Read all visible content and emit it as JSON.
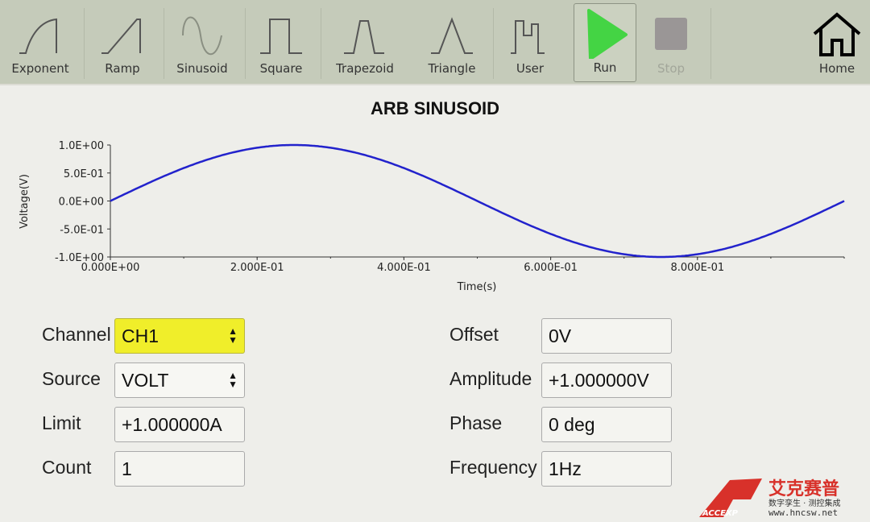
{
  "toolbar": {
    "items": [
      {
        "label": "Exponent",
        "icon": "exponent-wave-icon"
      },
      {
        "label": "Ramp",
        "icon": "ramp-wave-icon"
      },
      {
        "label": "Sinusoid",
        "icon": "sine-wave-icon"
      },
      {
        "label": "Square",
        "icon": "square-wave-icon"
      },
      {
        "label": "Trapezoid",
        "icon": "trapezoid-wave-icon"
      },
      {
        "label": "Triangle",
        "icon": "triangle-wave-icon"
      },
      {
        "label": "User",
        "icon": "user-wave-icon"
      },
      {
        "label": "Run",
        "icon": "play-icon"
      },
      {
        "label": "Stop",
        "icon": "stop-icon"
      },
      {
        "label": "Home",
        "icon": "home-icon"
      }
    ],
    "run_color": "#44d444",
    "stop_color": "#9a9696"
  },
  "title": "ARB SINUSOID",
  "chart_data": {
    "type": "line",
    "xlabel": "Time(s)",
    "ylabel": "Voltage(V)",
    "xlim": [
      0,
      1
    ],
    "ylim": [
      -1,
      1
    ],
    "xticks": [
      "0.000E+00",
      "2.000E-01",
      "4.000E-01",
      "6.000E-01",
      "8.000E-01"
    ],
    "xtick_values": [
      0,
      0.2,
      0.4,
      0.6,
      0.8
    ],
    "yticks": [
      "1.0E+00",
      "5.0E-01",
      "0.0E+00",
      "-5.0E-01",
      "-1.0E+00"
    ],
    "ytick_values": [
      1,
      0.5,
      0,
      -0.5,
      -1
    ],
    "series": [
      {
        "function": "sin(2*pi*t)",
        "amplitude": 1,
        "frequency": 1,
        "color": "#2222cc"
      }
    ],
    "grid": false
  },
  "form": {
    "channel": {
      "label": "Channel",
      "value": "CH1"
    },
    "source": {
      "label": "Source",
      "value": "VOLT"
    },
    "limit": {
      "label": "Limit",
      "value": "+1.000000A"
    },
    "count": {
      "label": "Count",
      "value": "1"
    },
    "offset": {
      "label": "Offset",
      "value": "0V"
    },
    "amplitude": {
      "label": "Amplitude",
      "value": "+1.000000V"
    },
    "phase": {
      "label": "Phase",
      "value": "0 deg"
    },
    "frequency": {
      "label": "Frequency",
      "value": "1Hz"
    }
  },
  "watermark": {
    "brand": "艾克赛普",
    "tagline": "数字孪生 · 测控集成",
    "url": "www.hncsw.net",
    "mark": "ACCEXP"
  }
}
